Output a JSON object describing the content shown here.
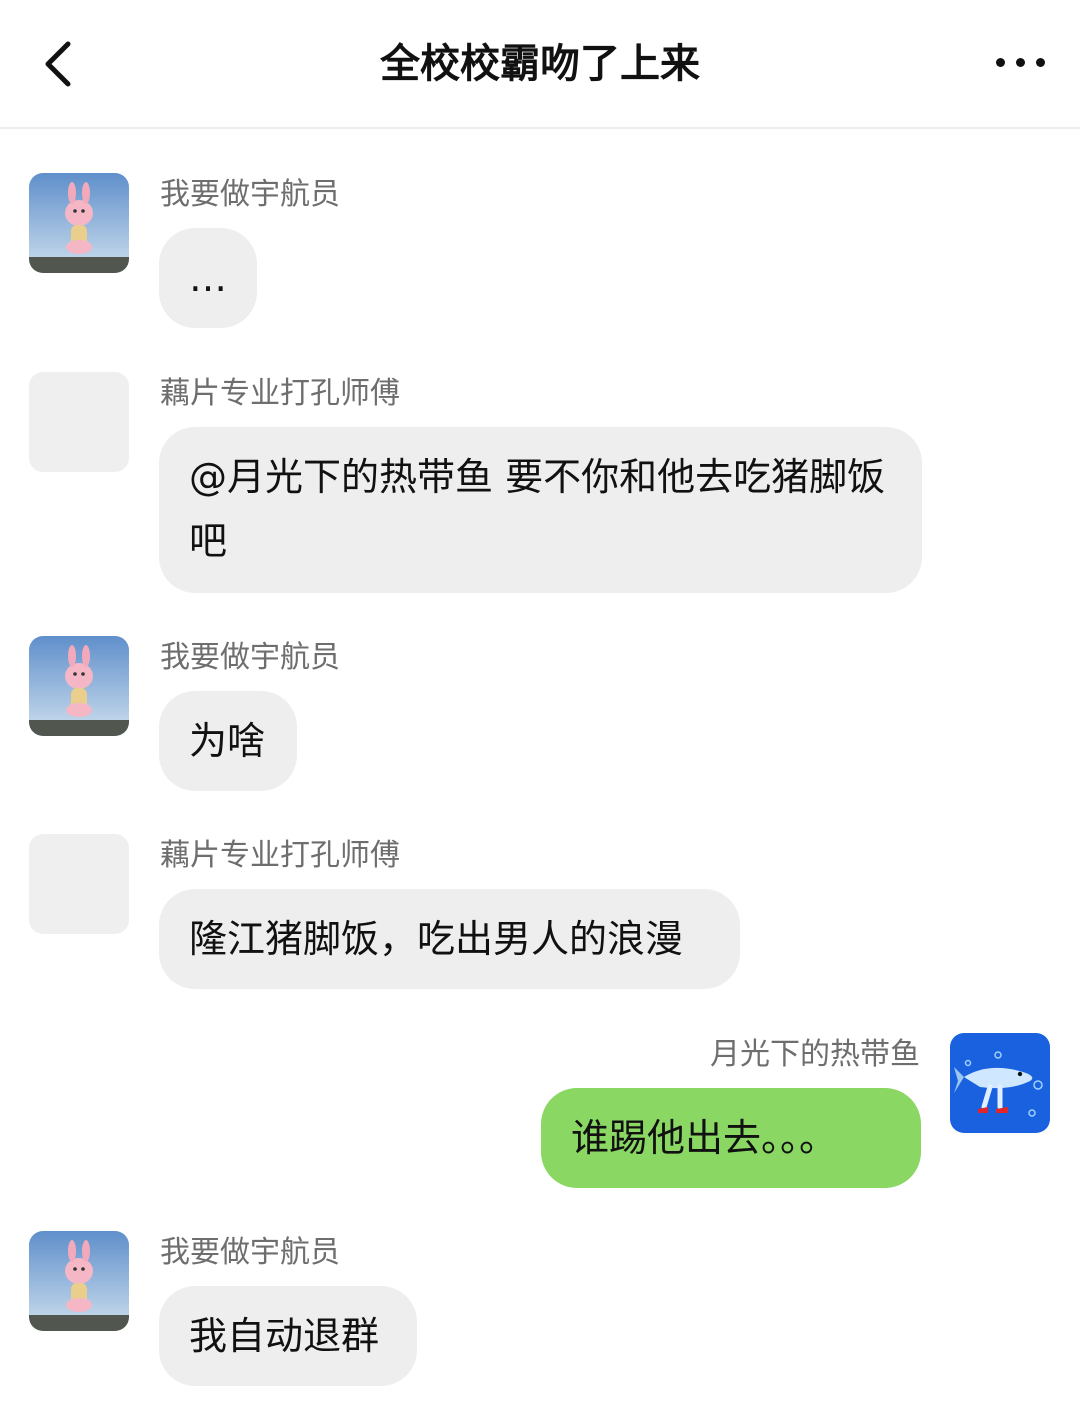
{
  "header": {
    "title": "全校校霸吻了上来",
    "back_icon": "chevron-left-icon",
    "more_icon": "more-horizontal-icon"
  },
  "colors": {
    "bubble_other": "#eeeeee",
    "bubble_mine": "#8ad763",
    "sender_text": "#6e6e6e",
    "message_text": "#111111"
  },
  "messages": [
    {
      "sender": "我要做宇航员",
      "text": "…",
      "side": "left",
      "avatar": "pink-rabbit-avatar"
    },
    {
      "sender": "藕片专业打孔师傅",
      "text": "@月光下的热带鱼 要不你和他去吃猪脚饭吧",
      "side": "left",
      "avatar": "blank-avatar"
    },
    {
      "sender": "我要做宇航员",
      "text": "为啥",
      "side": "left",
      "avatar": "pink-rabbit-avatar"
    },
    {
      "sender": "藕片专业打孔师傅",
      "text": "隆江猪脚饭，吃出男人的浪漫",
      "side": "left",
      "avatar": "blank-avatar"
    },
    {
      "sender": "月光下的热带鱼",
      "text": "谁踢他出去。。。",
      "side": "right",
      "avatar": "blue-fish-avatar"
    },
    {
      "sender": "我要做宇航员",
      "text": "我自动退群",
      "side": "left",
      "avatar": "pink-rabbit-avatar"
    }
  ]
}
